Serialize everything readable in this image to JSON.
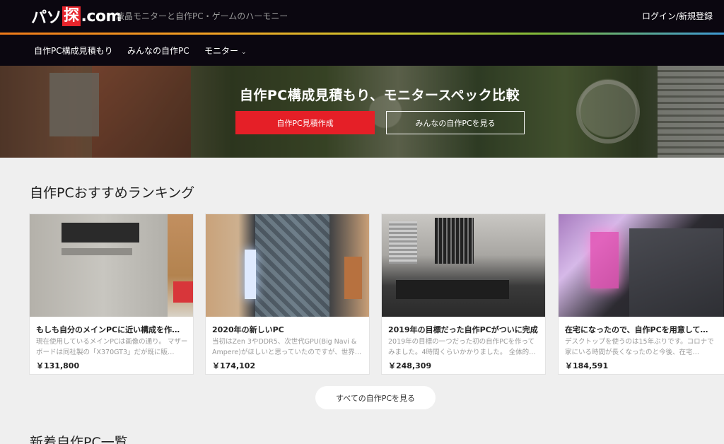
{
  "header": {
    "logo_part1": "パソ",
    "logo_box": "探",
    "logo_part2": ".com",
    "tagline": "液晶モニターと自作PC・ゲームのハーモニー",
    "login_label": "ログイン/新規登録"
  },
  "nav": {
    "items": [
      {
        "label": "自作PC構成見積もり"
      },
      {
        "label": "みんなの自作PC"
      },
      {
        "label": "モニター"
      }
    ]
  },
  "hero": {
    "title": "自作PC構成見積もり、モニタースペック比較",
    "primary_button": "自作PC見積作成",
    "secondary_button": "みんなの自作PCを見る"
  },
  "ranking": {
    "title": "自作PCおすすめランキング",
    "cards": [
      {
        "title": "もしも自分のメインPCに近い構成を作…",
        "desc": "現在使用しているメインPCは画像の通り。 マザーボードは同社製の「X370GT3」だが既に販…",
        "price": "￥131,800"
      },
      {
        "title": "2020年の新しいPC",
        "desc": "当初はZen 3やDDR5、次世代GPU(Big Navi & Ampere)がほしいと思っていたのですが、世界…",
        "price": "￥174,102"
      },
      {
        "title": "2019年の目標だった自作PCがついに完成",
        "desc": "2019年の目標の一つだった初の自作PCを作ってみました。4時間くらいかかりました。 全体的…",
        "price": "￥248,309"
      },
      {
        "title": "在宅になったので、自作PCを用意して…",
        "desc": "デスクトップを使うのは15年ぶりです。コロナで家にいる時間が長くなったのと今後、在宅…",
        "price": "￥184,591"
      }
    ],
    "all_button": "すべての自作PCを見る"
  },
  "new_section": {
    "title": "新着自作PC一覧"
  },
  "colors": {
    "header_bg": "#0b0710",
    "accent_red": "#e51f27",
    "page_bg": "#efefef"
  }
}
